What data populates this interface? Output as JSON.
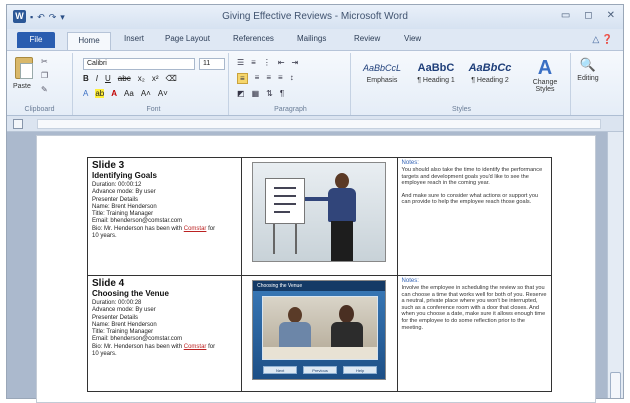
{
  "window": {
    "title": "Giving Effective Reviews - Microsoft Word",
    "controls": [
      "minimize-icon",
      "maximize-icon",
      "close-icon"
    ]
  },
  "qat": {
    "logo": "W",
    "icons": [
      "save-icon",
      "undo-icon",
      "redo-icon",
      "customize-icon"
    ]
  },
  "tabs": [
    "File",
    "Home",
    "Insert",
    "Page Layout",
    "References",
    "Mailings",
    "Review",
    "View"
  ],
  "ribbon": {
    "clipboard": {
      "paste": "Paste",
      "label": "Clipboard"
    },
    "font": {
      "name": "Calibri",
      "size": "11",
      "label": "Font"
    },
    "paragraph": {
      "label": "Paragraph"
    },
    "styles": {
      "label": "Styles",
      "items": [
        {
          "sample": "AaBbCcL",
          "name": "Emphasis"
        },
        {
          "sample": "AaBbC",
          "name": "¶ Heading 1"
        },
        {
          "sample": "AaBbCc",
          "name": "¶ Heading 2"
        }
      ],
      "change": "Change Styles",
      "change_glyph": "A"
    },
    "editing": {
      "label": "Editing"
    }
  },
  "document": {
    "rows": [
      {
        "slide": "Slide 3",
        "title": "Identifying Goals",
        "meta": [
          "Duration: 00:00:12",
          "Advance mode: By user",
          "Presenter Details",
          "Name: Brent Henderson",
          "Title: Training Manager",
          "Email: bhenderson@comstar.com",
          "Bio: Mr. Henderson has been with",
          "Comstar",
          " for",
          "10 years."
        ],
        "notes_label": "Notes:",
        "notes": [
          "You should also take the time to identify the performance targets and development goals you'd like to see the employee reach in the coming year.",
          "And make sure to consider what actions or support you can provide to help the employee reach those goals."
        ]
      },
      {
        "slide": "Slide 4",
        "title": "Choosing the Venue",
        "meta": [
          "Duration: 00:00:28",
          "Advance mode: By user",
          "Presenter Details",
          "Name: Brent Henderson",
          "Title: Training Manager",
          "Email: bhenderson@comstar.com",
          "Bio: Mr. Henderson has been with",
          "Comstar",
          " for",
          "10 years."
        ],
        "notes_label": "Notes:",
        "notes": [
          "Involve the employee in scheduling the review so that you can choose a time that works well for both of you. Reserve a neutral, private place where you won't be interrupted, such as a conference room with a door that closes. And when you choose a date, make sure it allows enough time for the employee to do some reflection prior to the meeting."
        ],
        "slide_banner": "Choosing the Venue",
        "slide_buttons": [
          "Next",
          "Previous",
          "Help"
        ]
      }
    ]
  }
}
